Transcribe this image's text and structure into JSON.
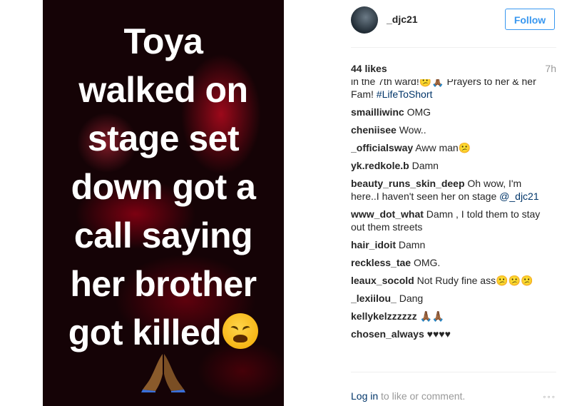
{
  "post": {
    "caption_lines": [
      "Toya",
      "walked on",
      "stage set",
      "down got a",
      "call saying",
      "her brother",
      "got killed"
    ],
    "emoji_end": "weary-face",
    "emoji_bottom": "folded-hands"
  },
  "header": {
    "username": "_djc21",
    "follow_label": "Follow"
  },
  "stats": {
    "likes": "44 likes",
    "time": "7h"
  },
  "caption_comment": {
    "text": "in the 7th ward!😕🙏🏾 Prayers to her & her Fam! ",
    "hashtag": "#LifeToShort"
  },
  "comments": [
    {
      "user": "smailliwinc",
      "text": "OMG"
    },
    {
      "user": "cheniisee",
      "text": "Wow.."
    },
    {
      "user": "_officialsway",
      "text": "Aww man😕"
    },
    {
      "user": "yk.redkole.b",
      "text": "Damn"
    },
    {
      "user": "beauty_runs_skin_deep",
      "text": "Oh wow, I'm here..I haven't seen her on stage ",
      "mention": "@_djc21"
    },
    {
      "user": "www_dot_what",
      "text": "Damn , I told them to stay out them streets"
    },
    {
      "user": "hair_idoit",
      "text": "Damn"
    },
    {
      "user": "reckless_tae",
      "text": "OMG."
    },
    {
      "user": "leaux_socold",
      "text": "Not Rudy fine ass😕😕😕"
    },
    {
      "user": "_lexiilou_",
      "text": "Dang"
    },
    {
      "user": "kellykelzzzzzz",
      "text": "🙏🏾🙏🏾"
    },
    {
      "user": "chosen_always",
      "text": "♥♥♥♥"
    }
  ],
  "footer": {
    "login_link": "Log in",
    "login_rest": " to like or comment.",
    "more": "◦◦◦"
  },
  "colors": {
    "link": "#3897f0",
    "dark_link": "#003569",
    "muted": "#999999"
  }
}
